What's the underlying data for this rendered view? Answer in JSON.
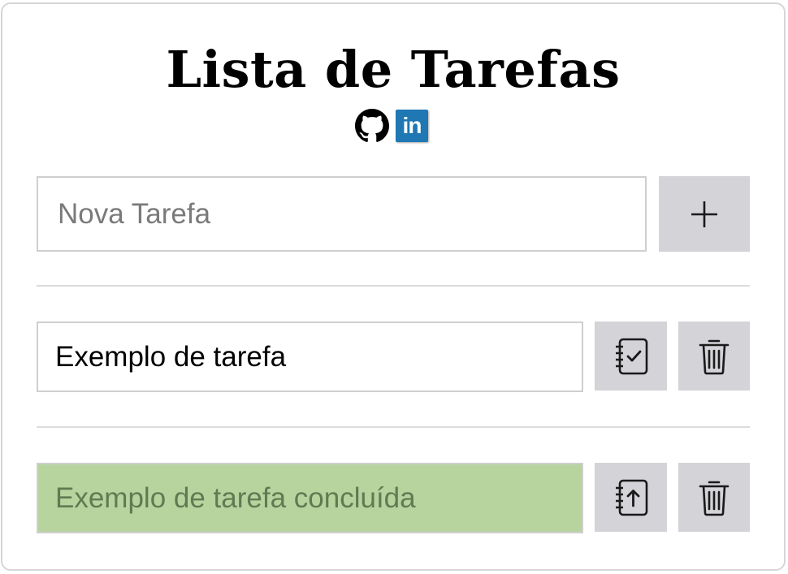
{
  "header": {
    "title": "Lista de Tarefas",
    "links": [
      {
        "name": "github",
        "icon": "github-icon"
      },
      {
        "name": "linkedin",
        "icon": "linkedin-icon",
        "label": "in",
        "color": "#1f77b4"
      }
    ]
  },
  "new_task": {
    "placeholder": "Nova Tarefa",
    "value": "",
    "add_icon": "plus-icon"
  },
  "tasks": [
    {
      "text": "Exemplo de tarefa",
      "completed": false,
      "action_icon": "notebook-check-icon",
      "delete_icon": "trash-icon"
    },
    {
      "text": "Exemplo de tarefa concluída",
      "completed": true,
      "action_icon": "notebook-upload-icon",
      "delete_icon": "trash-icon"
    }
  ],
  "colors": {
    "button_bg": "#d3d3d8",
    "completed_bg": "#b7d49f",
    "completed_text": "#617a52",
    "border": "#cfcfcf"
  }
}
